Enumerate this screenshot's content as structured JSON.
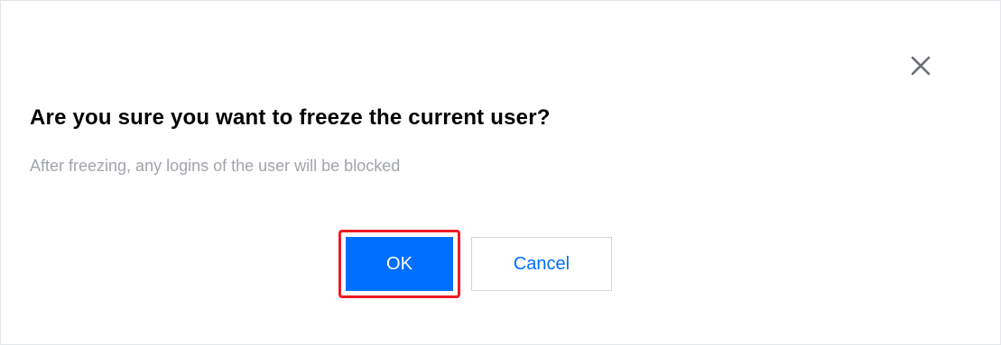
{
  "dialog": {
    "title": "Are you sure you want to freeze the current user?",
    "message": "After freezing, any logins of the user will be blocked",
    "close_icon": "close-icon",
    "ok_label": "OK",
    "cancel_label": "Cancel",
    "ok_highlighted": true
  },
  "colors": {
    "primary": "#006eff",
    "highlight_border": "#ee1c25",
    "message_text": "#a1a4aa",
    "title_text": "#000000"
  }
}
